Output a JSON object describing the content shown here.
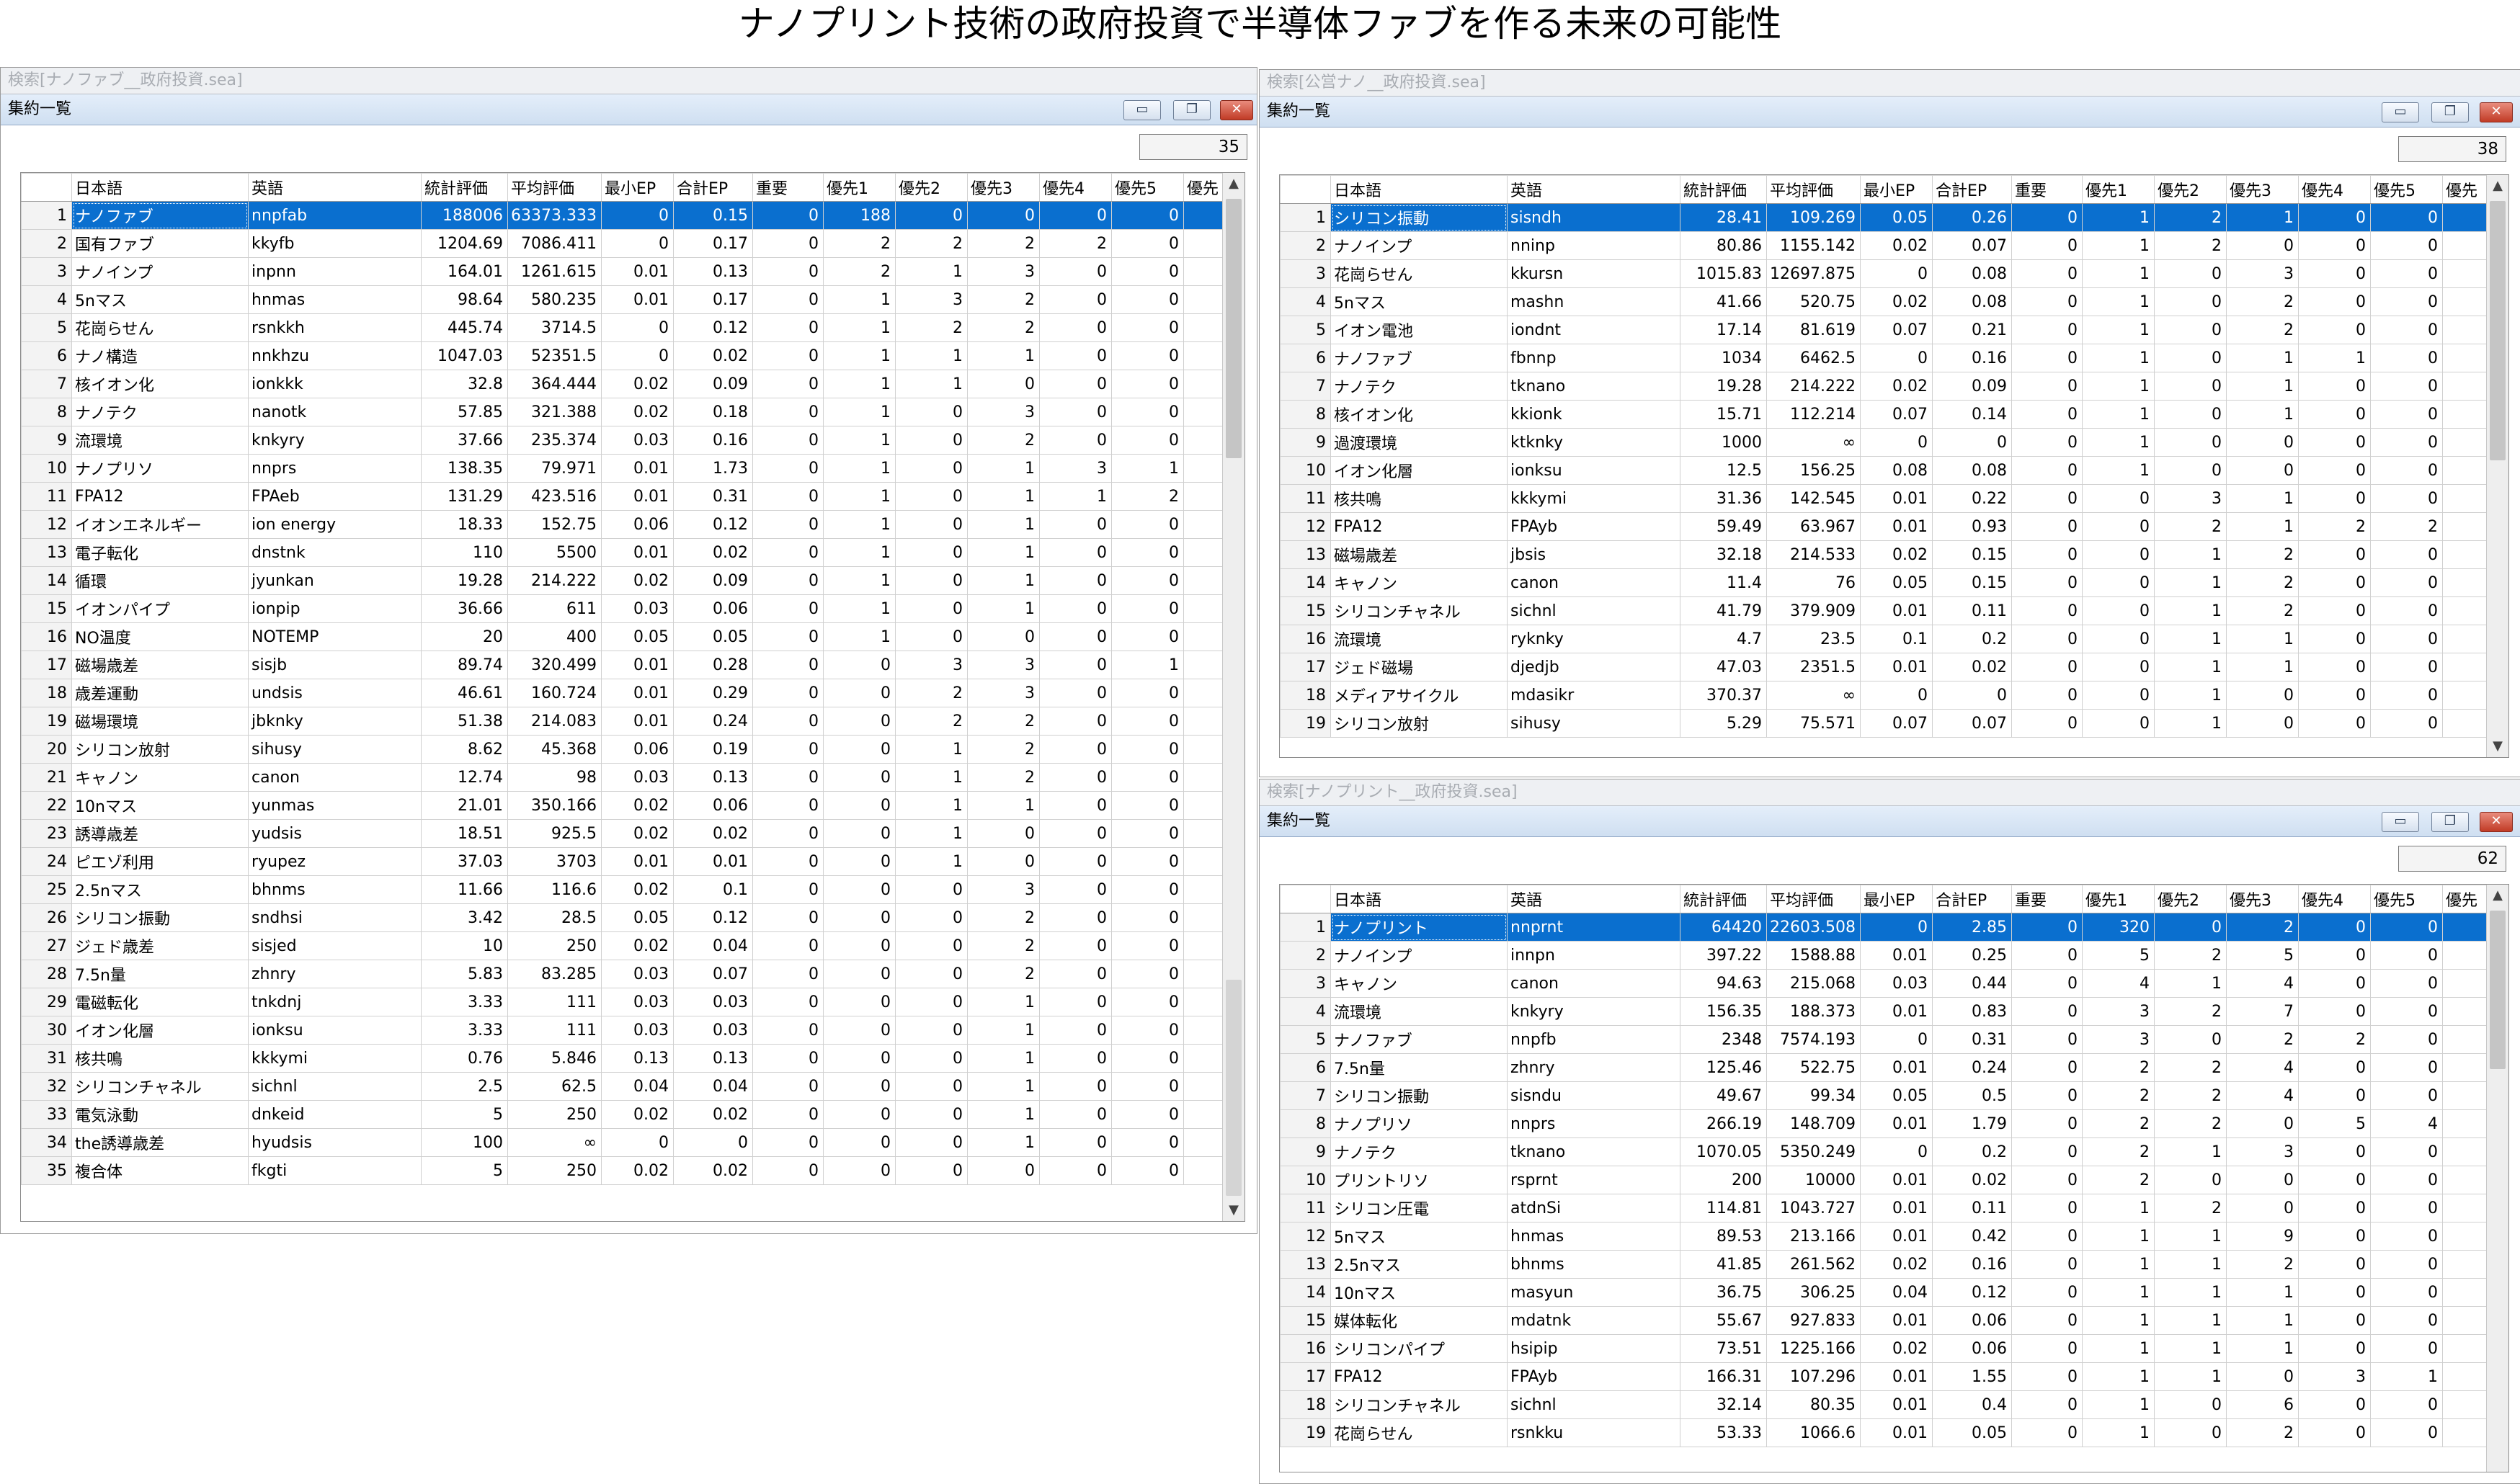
{
  "page_title": "ナノプリント技術の政府投資で半導体ファブを作る未来の可能性",
  "colors": {
    "selection": "#0a6fcf",
    "header_gradient": "#cfdff1",
    "window_bg": "#ffffff"
  },
  "icons": {
    "minimize": "minimize-icon",
    "restore": "restore-icon",
    "close": "close-icon"
  },
  "columns": [
    "日本語",
    "英語",
    "統計評価",
    "平均評価",
    "最小EP",
    "合計EP",
    "重要",
    "優先1",
    "優先2",
    "優先3",
    "優先4",
    "優先5",
    "優先"
  ],
  "windows": {
    "left": {
      "title": "検索[ナノファブ__政府投資.sea]",
      "subtitle": "集約一覧",
      "count": "35",
      "buttons": {
        "minimize": "▭",
        "restore": "❐",
        "close": "✕"
      },
      "rows": [
        [
          "1",
          "ナノファブ",
          "nnpfab",
          "188006",
          "63373.333",
          "0",
          "0.15",
          "0",
          "188",
          "0",
          "0",
          "0",
          "0"
        ],
        [
          "2",
          "国有ファブ",
          "kkyfb",
          "1204.69",
          "7086.411",
          "0",
          "0.17",
          "0",
          "2",
          "2",
          "2",
          "2",
          "0"
        ],
        [
          "3",
          "ナノインプ",
          "inpnn",
          "164.01",
          "1261.615",
          "0.01",
          "0.13",
          "0",
          "2",
          "1",
          "3",
          "0",
          "0"
        ],
        [
          "4",
          "5nマス",
          "hnmas",
          "98.64",
          "580.235",
          "0.01",
          "0.17",
          "0",
          "1",
          "3",
          "2",
          "0",
          "0"
        ],
        [
          "5",
          "花崗らせん",
          "rsnkkh",
          "445.74",
          "3714.5",
          "0",
          "0.12",
          "0",
          "1",
          "2",
          "2",
          "0",
          "0"
        ],
        [
          "6",
          "ナノ構造",
          "nnkhzu",
          "1047.03",
          "52351.5",
          "0",
          "0.02",
          "0",
          "1",
          "1",
          "1",
          "0",
          "0"
        ],
        [
          "7",
          "核イオン化",
          "ionkkk",
          "32.8",
          "364.444",
          "0.02",
          "0.09",
          "0",
          "1",
          "1",
          "0",
          "0",
          "0"
        ],
        [
          "8",
          "ナノテク",
          "nanotk",
          "57.85",
          "321.388",
          "0.02",
          "0.18",
          "0",
          "1",
          "0",
          "3",
          "0",
          "0"
        ],
        [
          "9",
          "流環境",
          "knkyry",
          "37.66",
          "235.374",
          "0.03",
          "0.16",
          "0",
          "1",
          "0",
          "2",
          "0",
          "0"
        ],
        [
          "10",
          "ナノプリソ",
          "nnprs",
          "138.35",
          "79.971",
          "0.01",
          "1.73",
          "0",
          "1",
          "0",
          "1",
          "3",
          "1"
        ],
        [
          "11",
          "FPA12",
          "FPAeb",
          "131.29",
          "423.516",
          "0.01",
          "0.31",
          "0",
          "1",
          "0",
          "1",
          "1",
          "2"
        ],
        [
          "12",
          "イオンエネルギー",
          "ion energy",
          "18.33",
          "152.75",
          "0.06",
          "0.12",
          "0",
          "1",
          "0",
          "1",
          "0",
          "0"
        ],
        [
          "13",
          "電子転化",
          "dnstnk",
          "110",
          "5500",
          "0.01",
          "0.02",
          "0",
          "1",
          "0",
          "1",
          "0",
          "0"
        ],
        [
          "14",
          "循環",
          "jyunkan",
          "19.28",
          "214.222",
          "0.02",
          "0.09",
          "0",
          "1",
          "0",
          "1",
          "0",
          "0"
        ],
        [
          "15",
          "イオンパイプ",
          "ionpip",
          "36.66",
          "611",
          "0.03",
          "0.06",
          "0",
          "1",
          "0",
          "1",
          "0",
          "0"
        ],
        [
          "16",
          "NO温度",
          "NOTEMP",
          "20",
          "400",
          "0.05",
          "0.05",
          "0",
          "1",
          "0",
          "0",
          "0",
          "0"
        ],
        [
          "17",
          "磁場歳差",
          "sisjb",
          "89.74",
          "320.499",
          "0.01",
          "0.28",
          "0",
          "0",
          "3",
          "3",
          "0",
          "1"
        ],
        [
          "18",
          "歳差運動",
          "undsis",
          "46.61",
          "160.724",
          "0.01",
          "0.29",
          "0",
          "0",
          "2",
          "3",
          "0",
          "0"
        ],
        [
          "19",
          "磁場環境",
          "jbknky",
          "51.38",
          "214.083",
          "0.01",
          "0.24",
          "0",
          "0",
          "2",
          "2",
          "0",
          "0"
        ],
        [
          "20",
          "シリコン放射",
          "sihusy",
          "8.62",
          "45.368",
          "0.06",
          "0.19",
          "0",
          "0",
          "1",
          "2",
          "0",
          "0"
        ],
        [
          "21",
          "キャノン",
          "canon",
          "12.74",
          "98",
          "0.03",
          "0.13",
          "0",
          "0",
          "1",
          "2",
          "0",
          "0"
        ],
        [
          "22",
          "10nマス",
          "yunmas",
          "21.01",
          "350.166",
          "0.02",
          "0.06",
          "0",
          "0",
          "1",
          "1",
          "0",
          "0"
        ],
        [
          "23",
          "誘導歳差",
          "yudsis",
          "18.51",
          "925.5",
          "0.02",
          "0.02",
          "0",
          "0",
          "1",
          "0",
          "0",
          "0"
        ],
        [
          "24",
          "ピエゾ利用",
          "ryupez",
          "37.03",
          "3703",
          "0.01",
          "0.01",
          "0",
          "0",
          "1",
          "0",
          "0",
          "0"
        ],
        [
          "25",
          "2.5nマス",
          "bhnms",
          "11.66",
          "116.6",
          "0.02",
          "0.1",
          "0",
          "0",
          "0",
          "3",
          "0",
          "0"
        ],
        [
          "26",
          "シリコン振動",
          "sndhsi",
          "3.42",
          "28.5",
          "0.05",
          "0.12",
          "0",
          "0",
          "0",
          "2",
          "0",
          "0"
        ],
        [
          "27",
          "ジェド歳差",
          "sisjed",
          "10",
          "250",
          "0.02",
          "0.04",
          "0",
          "0",
          "0",
          "2",
          "0",
          "0"
        ],
        [
          "28",
          "7.5n量",
          "zhnry",
          "5.83",
          "83.285",
          "0.03",
          "0.07",
          "0",
          "0",
          "0",
          "2",
          "0",
          "0"
        ],
        [
          "29",
          "電磁転化",
          "tnkdnj",
          "3.33",
          "111",
          "0.03",
          "0.03",
          "0",
          "0",
          "0",
          "1",
          "0",
          "0"
        ],
        [
          "30",
          "イオン化層",
          "ionksu",
          "3.33",
          "111",
          "0.03",
          "0.03",
          "0",
          "0",
          "0",
          "1",
          "0",
          "0"
        ],
        [
          "31",
          "核共鳴",
          "kkkymi",
          "0.76",
          "5.846",
          "0.13",
          "0.13",
          "0",
          "0",
          "0",
          "1",
          "0",
          "0"
        ],
        [
          "32",
          "シリコンチャネル",
          "sichnl",
          "2.5",
          "62.5",
          "0.04",
          "0.04",
          "0",
          "0",
          "0",
          "1",
          "0",
          "0"
        ],
        [
          "33",
          "電気泳動",
          "dnkeid",
          "5",
          "250",
          "0.02",
          "0.02",
          "0",
          "0",
          "0",
          "1",
          "0",
          "0"
        ],
        [
          "34",
          "the誘導歳差",
          "hyudsis",
          "100",
          "∞",
          "0",
          "0",
          "0",
          "0",
          "0",
          "1",
          "0",
          "0"
        ],
        [
          "35",
          "複合体",
          "fkgti",
          "5",
          "250",
          "0.02",
          "0.02",
          "0",
          "0",
          "0",
          "0",
          "0",
          "0"
        ]
      ]
    },
    "right_top": {
      "title": "検索[公営ナノ__政府投資.sea]",
      "subtitle": "集約一覧",
      "count": "38",
      "buttons": {
        "minimize": "▭",
        "restore": "❐",
        "close": "✕"
      },
      "rows": [
        [
          "1",
          "シリコン振動",
          "sisndh",
          "28.41",
          "109.269",
          "0.05",
          "0.26",
          "0",
          "1",
          "2",
          "1",
          "0",
          "0"
        ],
        [
          "2",
          "ナノインプ",
          "nninp",
          "80.86",
          "1155.142",
          "0.02",
          "0.07",
          "0",
          "1",
          "2",
          "0",
          "0",
          "0"
        ],
        [
          "3",
          "花崗らせん",
          "kkursn",
          "1015.83",
          "12697.875",
          "0",
          "0.08",
          "0",
          "1",
          "0",
          "3",
          "0",
          "0"
        ],
        [
          "4",
          "5nマス",
          "mashn",
          "41.66",
          "520.75",
          "0.02",
          "0.08",
          "0",
          "1",
          "0",
          "2",
          "0",
          "0"
        ],
        [
          "5",
          "イオン電池",
          "iondnt",
          "17.14",
          "81.619",
          "0.07",
          "0.21",
          "0",
          "1",
          "0",
          "2",
          "0",
          "0"
        ],
        [
          "6",
          "ナノファブ",
          "fbnnp",
          "1034",
          "6462.5",
          "0",
          "0.16",
          "0",
          "1",
          "0",
          "1",
          "1",
          "0"
        ],
        [
          "7",
          "ナノテク",
          "tknano",
          "19.28",
          "214.222",
          "0.02",
          "0.09",
          "0",
          "1",
          "0",
          "1",
          "0",
          "0"
        ],
        [
          "8",
          "核イオン化",
          "kkionk",
          "15.71",
          "112.214",
          "0.07",
          "0.14",
          "0",
          "1",
          "0",
          "1",
          "0",
          "0"
        ],
        [
          "9",
          "過渡環境",
          "ktknky",
          "1000",
          "∞",
          "0",
          "0",
          "0",
          "1",
          "0",
          "0",
          "0",
          "0"
        ],
        [
          "10",
          "イオン化層",
          "ionksu",
          "12.5",
          "156.25",
          "0.08",
          "0.08",
          "0",
          "1",
          "0",
          "0",
          "0",
          "0"
        ],
        [
          "11",
          "核共鳴",
          "kkkymi",
          "31.36",
          "142.545",
          "0.01",
          "0.22",
          "0",
          "0",
          "3",
          "1",
          "0",
          "0"
        ],
        [
          "12",
          "FPA12",
          "FPAyb",
          "59.49",
          "63.967",
          "0.01",
          "0.93",
          "0",
          "0",
          "2",
          "1",
          "2",
          "2"
        ],
        [
          "13",
          "磁場歳差",
          "jbsis",
          "32.18",
          "214.533",
          "0.02",
          "0.15",
          "0",
          "0",
          "1",
          "2",
          "0",
          "0"
        ],
        [
          "14",
          "キャノン",
          "canon",
          "11.4",
          "76",
          "0.05",
          "0.15",
          "0",
          "0",
          "1",
          "2",
          "0",
          "0"
        ],
        [
          "15",
          "シリコンチャネル",
          "sichnl",
          "41.79",
          "379.909",
          "0.01",
          "0.11",
          "0",
          "0",
          "1",
          "2",
          "0",
          "0"
        ],
        [
          "16",
          "流環境",
          "ryknky",
          "4.7",
          "23.5",
          "0.1",
          "0.2",
          "0",
          "0",
          "1",
          "1",
          "0",
          "0"
        ],
        [
          "17",
          "ジェド磁場",
          "djedjb",
          "47.03",
          "2351.5",
          "0.01",
          "0.02",
          "0",
          "0",
          "1",
          "1",
          "0",
          "0"
        ],
        [
          "18",
          "メディアサイクル",
          "mdasikr",
          "370.37",
          "∞",
          "0",
          "0",
          "0",
          "0",
          "1",
          "0",
          "0",
          "0"
        ],
        [
          "19",
          "シリコン放射",
          "sihusy",
          "5.29",
          "75.571",
          "0.07",
          "0.07",
          "0",
          "0",
          "1",
          "0",
          "0",
          "0"
        ]
      ]
    },
    "right_bottom": {
      "title": "検索[ナノプリント__政府投資.sea]",
      "subtitle": "集約一覧",
      "count": "62",
      "buttons": {
        "minimize": "▭",
        "restore": "❐",
        "close": "✕"
      },
      "rows": [
        [
          "1",
          "ナノプリント",
          "nnprnt",
          "64420",
          "22603.508",
          "0",
          "2.85",
          "0",
          "320",
          "0",
          "2",
          "0",
          "0"
        ],
        [
          "2",
          "ナノインプ",
          "innpn",
          "397.22",
          "1588.88",
          "0.01",
          "0.25",
          "0",
          "5",
          "2",
          "5",
          "0",
          "0"
        ],
        [
          "3",
          "キャノン",
          "canon",
          "94.63",
          "215.068",
          "0.03",
          "0.44",
          "0",
          "4",
          "1",
          "4",
          "0",
          "0"
        ],
        [
          "4",
          "流環境",
          "knkyry",
          "156.35",
          "188.373",
          "0.01",
          "0.83",
          "0",
          "3",
          "2",
          "7",
          "0",
          "0"
        ],
        [
          "5",
          "ナノファブ",
          "nnpfb",
          "2348",
          "7574.193",
          "0",
          "0.31",
          "0",
          "3",
          "0",
          "2",
          "2",
          "0"
        ],
        [
          "6",
          "7.5n量",
          "zhnry",
          "125.46",
          "522.75",
          "0.01",
          "0.24",
          "0",
          "2",
          "2",
          "4",
          "0",
          "0"
        ],
        [
          "7",
          "シリコン振動",
          "sisndu",
          "49.67",
          "99.34",
          "0.05",
          "0.5",
          "0",
          "2",
          "2",
          "4",
          "0",
          "0"
        ],
        [
          "8",
          "ナノプリソ",
          "nnprs",
          "266.19",
          "148.709",
          "0.01",
          "1.79",
          "0",
          "2",
          "2",
          "0",
          "5",
          "4"
        ],
        [
          "9",
          "ナノテク",
          "tknano",
          "1070.05",
          "5350.249",
          "0",
          "0.2",
          "0",
          "2",
          "1",
          "3",
          "0",
          "0"
        ],
        [
          "10",
          "プリントリソ",
          "rsprnt",
          "200",
          "10000",
          "0.01",
          "0.02",
          "0",
          "2",
          "0",
          "0",
          "0",
          "0"
        ],
        [
          "11",
          "シリコン圧電",
          "atdnSi",
          "114.81",
          "1043.727",
          "0.01",
          "0.11",
          "0",
          "1",
          "2",
          "0",
          "0",
          "0"
        ],
        [
          "12",
          "5nマス",
          "hnmas",
          "89.53",
          "213.166",
          "0.01",
          "0.42",
          "0",
          "1",
          "1",
          "9",
          "0",
          "0"
        ],
        [
          "13",
          "2.5nマス",
          "bhnms",
          "41.85",
          "261.562",
          "0.02",
          "0.16",
          "0",
          "1",
          "1",
          "2",
          "0",
          "0"
        ],
        [
          "14",
          "10nマス",
          "masyun",
          "36.75",
          "306.25",
          "0.04",
          "0.12",
          "0",
          "1",
          "1",
          "1",
          "0",
          "0"
        ],
        [
          "15",
          "媒体転化",
          "mdatnk",
          "55.67",
          "927.833",
          "0.01",
          "0.06",
          "0",
          "1",
          "1",
          "1",
          "0",
          "0"
        ],
        [
          "16",
          "シリコンパイプ",
          "hsipip",
          "73.51",
          "1225.166",
          "0.02",
          "0.06",
          "0",
          "1",
          "1",
          "1",
          "0",
          "0"
        ],
        [
          "17",
          "FPA12",
          "FPAyb",
          "166.31",
          "107.296",
          "0.01",
          "1.55",
          "0",
          "1",
          "1",
          "0",
          "3",
          "1"
        ],
        [
          "18",
          "シリコンチャネル",
          "sichnl",
          "32.14",
          "80.35",
          "0.01",
          "0.4",
          "0",
          "1",
          "0",
          "6",
          "0",
          "0"
        ],
        [
          "19",
          "花崗らせん",
          "rsnkku",
          "53.33",
          "1066.6",
          "0.01",
          "0.05",
          "0",
          "1",
          "0",
          "2",
          "0",
          "0"
        ]
      ]
    }
  }
}
